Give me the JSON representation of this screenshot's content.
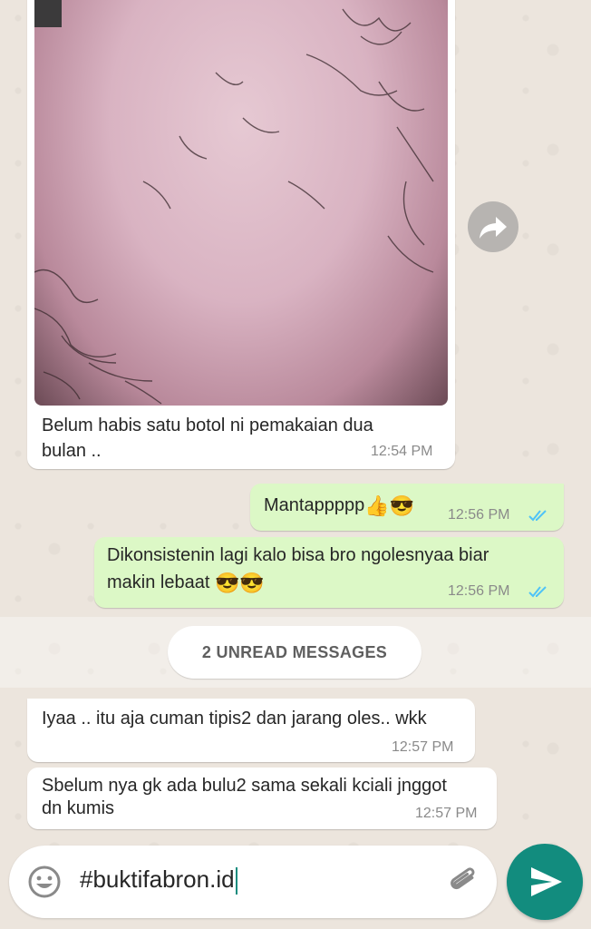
{
  "messages": [
    {
      "direction": "in",
      "has_image": true,
      "lines": [
        "Belum habis satu botol ni pemakaian dua",
        "bulan .."
      ],
      "time": "12:54 PM"
    },
    {
      "direction": "out",
      "text": "Mantappppp",
      "emojis": [
        "👍",
        "😎"
      ],
      "time": "12:56 PM",
      "status": "read"
    },
    {
      "direction": "out",
      "lines": [
        "Dikonsistenin lagi kalo bisa bro ngolesnyaa biar",
        "makin lebaat"
      ],
      "emojis": [
        "😎",
        "😎"
      ],
      "time": "12:56 PM",
      "status": "read"
    },
    {
      "direction": "in",
      "text": "Iyaa .. itu aja cuman tipis2 dan jarang oles.. wkk",
      "time": "12:57 PM"
    },
    {
      "direction": "in",
      "lines": [
        "Sbelum nya gk ada bulu2 sama sekali kciali jnggot",
        "dn kumis"
      ],
      "time": "12:57 PM"
    }
  ],
  "unread_divider": "2 UNREAD MESSAGES",
  "composer": {
    "value": "#buktifabron.id",
    "emoji_icon": "emoji-icon",
    "attach_icon": "paperclip-icon",
    "send_icon": "send-icon"
  },
  "forward_icon": "forward-icon",
  "colors": {
    "incoming": "#ffffff",
    "outgoing": "#dcf8c6",
    "accent": "#128c7e",
    "read_ticks": "#4fc3f7",
    "wallpaper": "#ece5dd"
  }
}
